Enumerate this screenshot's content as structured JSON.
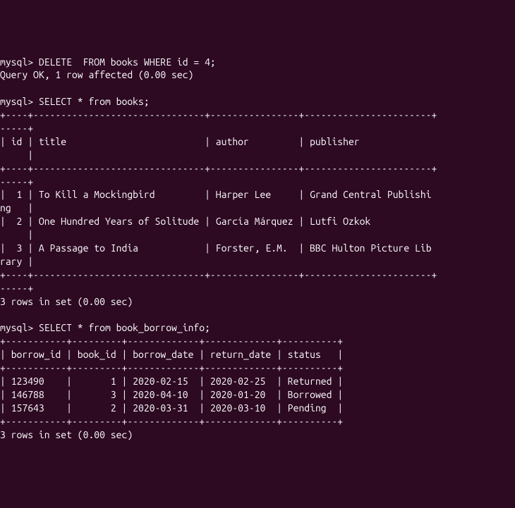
{
  "prompt": "mysql>",
  "cmd1": "DELETE  FROM books WHERE id = 4;",
  "cmd1_result": "Query OK, 1 row affected (0.00 sec)",
  "cmd2": "SELECT * from books;",
  "books_header": {
    "id": "id",
    "title": "title",
    "author": "author",
    "publisher": "publisher"
  },
  "books_rows": [
    {
      "id": "1",
      "title": "To Kill a Mockingbird",
      "author": "Harper Lee",
      "publisher_line1": "Grand Central Publishi",
      "publisher_wrap": "ng"
    },
    {
      "id": "2",
      "title": "One Hundred Years of Solitude",
      "author": "García Márquez",
      "publisher_line1": "Lutfi Ozkok",
      "publisher_wrap": ""
    },
    {
      "id": "3",
      "title": "A Passage to India",
      "author": "Forster, E.M.",
      "publisher_line1": "BBC Hulton Picture Lib",
      "publisher_wrap": "rary"
    }
  ],
  "books_footer": "3 rows in set (0.00 sec)",
  "cmd3": "SELECT * from book_borrow_info;",
  "borrow_header": {
    "borrow_id": "borrow_id",
    "book_id": "book_id",
    "borrow_date": "borrow_date",
    "return_date": "return_date",
    "status": "status"
  },
  "borrow_rows": [
    {
      "borrow_id": "123490",
      "book_id": "1",
      "borrow_date": "2020-02-15",
      "return_date": "2020-02-25",
      "status": "Returned"
    },
    {
      "borrow_id": "146788",
      "book_id": "3",
      "borrow_date": "2020-04-10",
      "return_date": "2020-01-20",
      "status": "Borrowed"
    },
    {
      "borrow_id": "157643",
      "book_id": "2",
      "borrow_date": "2020-03-31",
      "return_date": "2020-03-10",
      "status": "Pending"
    }
  ],
  "borrow_footer": "3 rows in set (0.00 sec)",
  "books_sep_top": "+----+-------------------------------+----------------+-----------------------+",
  "books_sep_wrap": "-----+",
  "borrow_sep": "+-----------+---------+-------------+-------------+----------+",
  "chart_data": {
    "type": "table",
    "title": "MySQL CLI output: books and book_borrow_info",
    "tables": [
      {
        "name": "books",
        "columns": [
          "id",
          "title",
          "author",
          "publisher"
        ],
        "rows": [
          [
            1,
            "To Kill a Mockingbird",
            "Harper Lee",
            "Grand Central Publishing"
          ],
          [
            2,
            "One Hundred Years of Solitude",
            "García Márquez",
            "Lutfi Ozkok"
          ],
          [
            3,
            "A Passage to India",
            "Forster, E.M.",
            "BBC Hulton Picture Library"
          ]
        ]
      },
      {
        "name": "book_borrow_info",
        "columns": [
          "borrow_id",
          "book_id",
          "borrow_date",
          "return_date",
          "status"
        ],
        "rows": [
          [
            123490,
            1,
            "2020-02-15",
            "2020-02-25",
            "Returned"
          ],
          [
            146788,
            3,
            "2020-04-10",
            "2020-01-20",
            "Borrowed"
          ],
          [
            157643,
            2,
            "2020-03-31",
            "2020-03-10",
            "Pending"
          ]
        ]
      }
    ]
  }
}
